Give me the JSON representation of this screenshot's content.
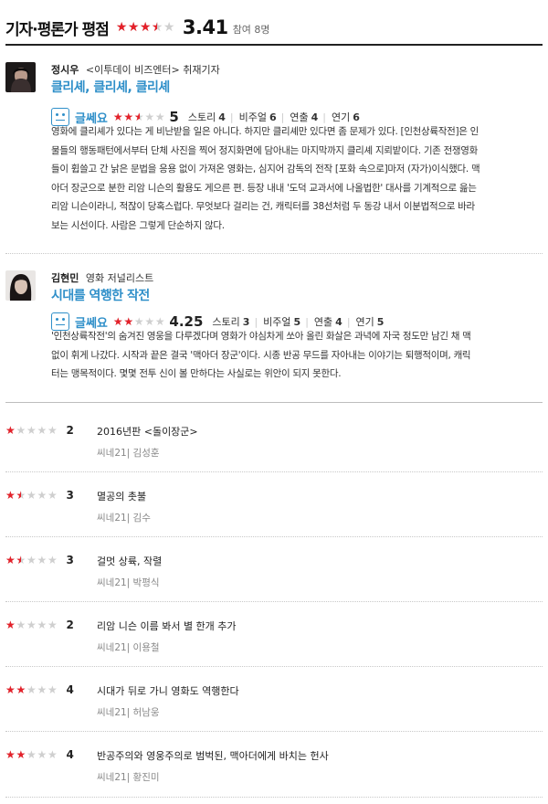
{
  "header": {
    "title": "기자·평론가 평점",
    "score": "3.41",
    "rating_value": 3.41,
    "rating_max": 5,
    "participants": "참여 8명"
  },
  "critic_reviews": [
    {
      "name": "정시우",
      "outlet": "<이투데이 비즈엔터> 취재기자",
      "title": "클리셰, 클리셰, 클리셰",
      "verdict": "글쎄요",
      "rating_value": 5,
      "rating_max": 10,
      "score": "5",
      "sub_scores": [
        {
          "label": "스토리",
          "value": "4"
        },
        {
          "label": "비주얼",
          "value": "6"
        },
        {
          "label": "연출",
          "value": "4"
        },
        {
          "label": "연기",
          "value": "6"
        }
      ],
      "body_lines": [
        "영화에 클리셰가 있다는 게 비난받을 일은 아니다. 하지만 클리셰만 있다면 좀 문제가 있다. [인천상륙작전]은 인",
        "물들의 행동패턴에서부터 단체 사진을 찍어 정지화면에 담아내는 마지막까지 클리셰 지뢰밭이다. 기존 전쟁영화",
        "들이 휩쓸고 간 낡은 문법을 응용 없이 가져온 영화는, 심지어 감독의 전작 [포화 속으로]마저 (자가)이식했다. 맥",
        "아더 장군으로 분한 리암 니슨의 활용도 게으른 편. 등장 내내 '도덕 교과서에 나올법한' 대사를 기계적으로 읊는",
        "리암 니슨이라니, 적잖이 당혹스럽다. 무엇보다 걸리는 건, 캐릭터를 38선처럼 두 동강 내서 이분법적으로 바라",
        "보는 시선이다. 사람은 그렇게 단순하지 않다."
      ]
    },
    {
      "name": "김현민",
      "outlet": "영화 저널리스트",
      "title": "시대를 역행한 작전",
      "verdict": "글쎄요",
      "rating_value": 4.25,
      "rating_max": 10,
      "score": "4.25",
      "sub_scores": [
        {
          "label": "스토리",
          "value": "3"
        },
        {
          "label": "비주얼",
          "value": "5"
        },
        {
          "label": "연출",
          "value": "4"
        },
        {
          "label": "연기",
          "value": "5"
        }
      ],
      "body_lines": [
        "'인천상륙작전'의 숨겨진 영웅을 다루겠다며 영화가 야심차게 쏘아 올린 화살은 과녁에 자국 정도만 남긴 채 맥",
        "없이 휘게 나갔다. 시작과 끝은 결국 '맥아더 장군'이다. 시종 반공 무드를 자아내는 이야기는 퇴행적이며, 캐릭",
        "터는 맹목적이다. 몇몇 전투 신이 볼 만하다는 사실로는 위안이 되지 못한다."
      ]
    }
  ],
  "short_reviews": [
    {
      "rating_value": 2,
      "score": "2",
      "text": "2016년판 <돌이장군>",
      "byline": "씨네21| 김성훈"
    },
    {
      "rating_value": 3,
      "score": "3",
      "text": "멸공의 촛불",
      "byline": "씨네21| 김수"
    },
    {
      "rating_value": 3,
      "score": "3",
      "text": "걸멋 상륙, 작렬",
      "byline": "씨네21| 박평식"
    },
    {
      "rating_value": 2,
      "score": "2",
      "text": "리암 니슨 이름 봐서 별 한개 추가",
      "byline": "씨네21| 이용철"
    },
    {
      "rating_value": 4,
      "score": "4",
      "text": "시대가 뒤로 가니 영화도 역행한다",
      "byline": "씨네21| 허남웅"
    },
    {
      "rating_value": 4,
      "score": "4",
      "text": "반공주의와 영웅주의로 범벅된, 맥아더에게 바치는 헌사",
      "byline": "씨네21| 황진미"
    }
  ],
  "colors": {
    "star_on": "#e4212a",
    "star_off": "#cfcfcf",
    "accent": "#2f8fc9"
  },
  "icons": {
    "verdict": "meh-face-icon",
    "star": "star-icon"
  }
}
